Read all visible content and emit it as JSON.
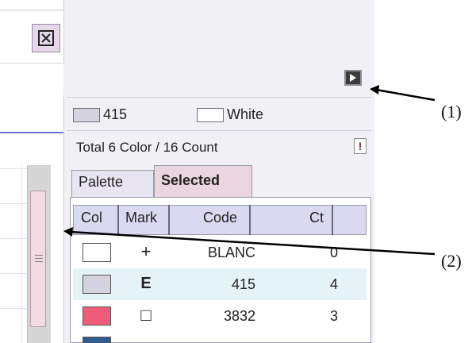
{
  "toolbar": {
    "buttons": [
      {
        "icon": "square-x-icon"
      },
      {
        "icon": "grid-icon"
      },
      {
        "icon": "close-x-icon"
      }
    ]
  },
  "panel": {
    "collapse_icon": "play-icon",
    "colors": [
      {
        "label": "415",
        "swatch": "#d4d3df"
      },
      {
        "label": "White",
        "swatch": "#ffffff"
      }
    ],
    "total": "Total 6 Color / 16 Count",
    "info_label": "!",
    "tabs": [
      "Palette",
      "Selected"
    ],
    "active_tab": "Selected",
    "table": {
      "headers": [
        "Col",
        "Mark",
        "Code",
        "Ct"
      ],
      "rows": [
        {
          "color": "#ffffff",
          "mark": "+",
          "code": "BLANC",
          "count": "0"
        },
        {
          "color": "#d4d3df",
          "mark": "E",
          "code": "415",
          "count": "4"
        },
        {
          "color": "#ef5c7a",
          "mark": "□",
          "code": "3832",
          "count": "3"
        }
      ]
    }
  },
  "annotations": [
    "(1)",
    "(2)"
  ]
}
